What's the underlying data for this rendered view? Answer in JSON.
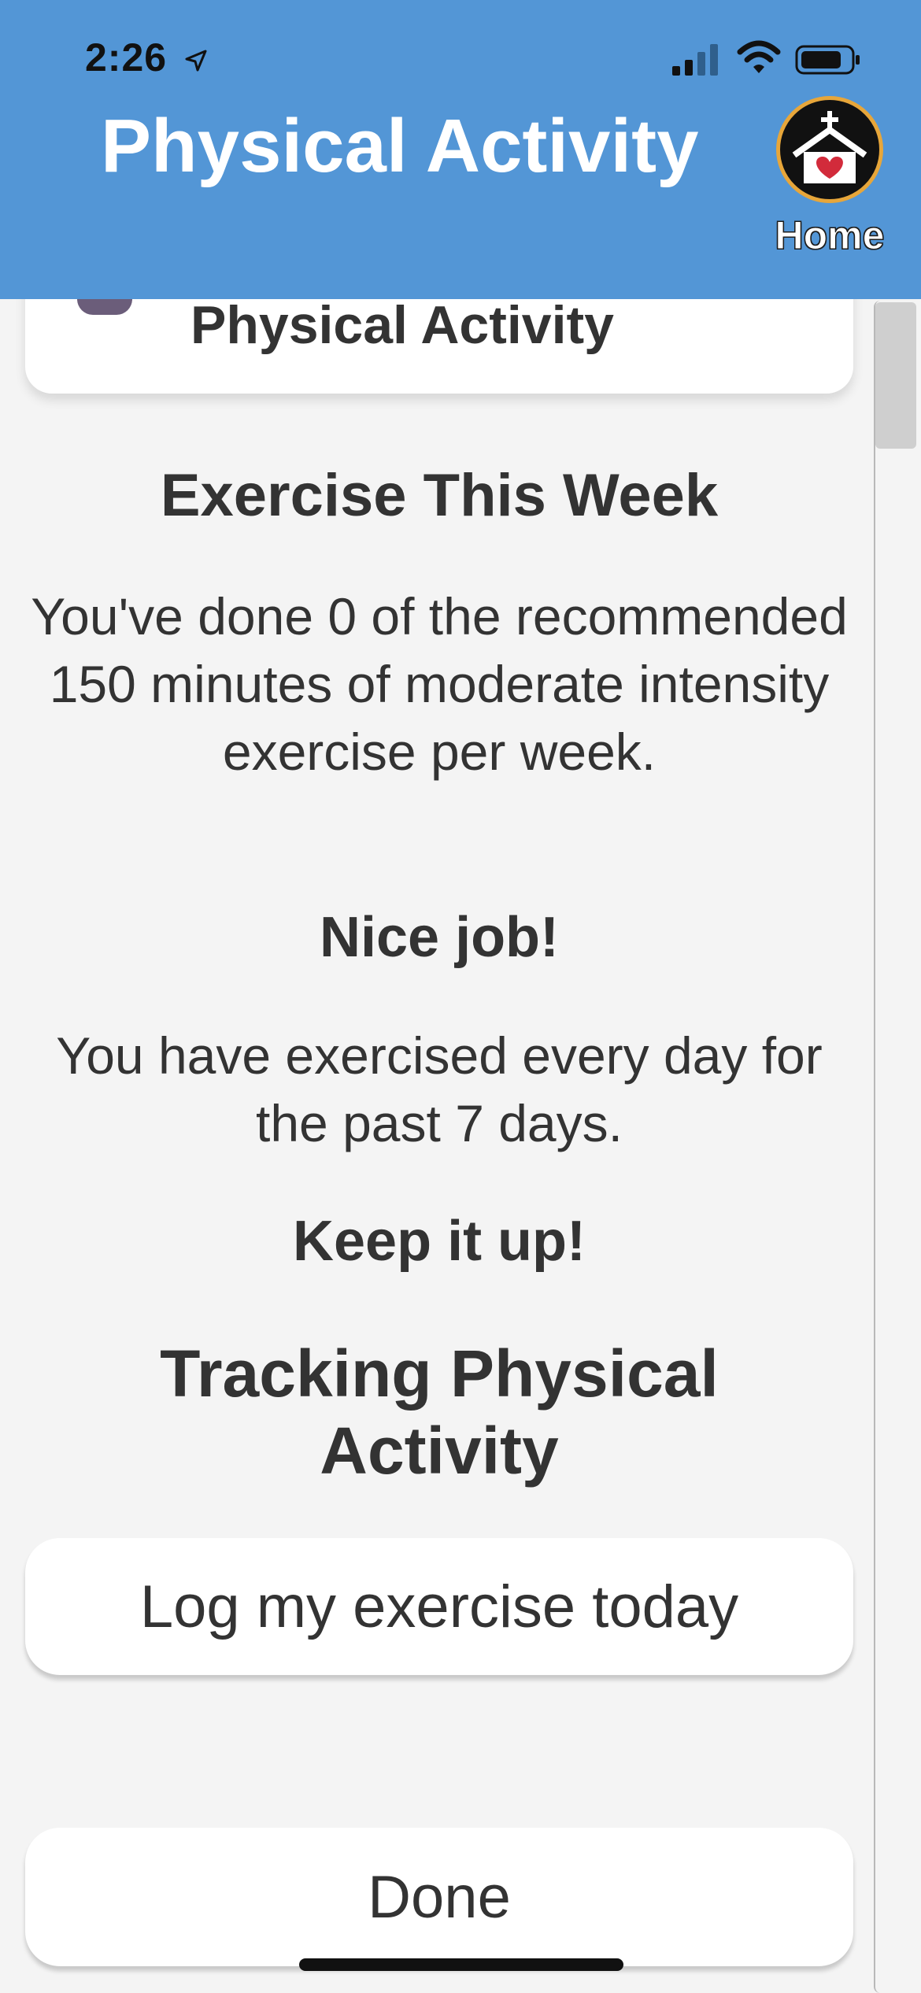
{
  "status_bar": {
    "time": "2:26"
  },
  "header": {
    "title": "Physical Activity",
    "home_label": "Home"
  },
  "top_card": {
    "title": "Physical Activity"
  },
  "exercise_section": {
    "heading": "Exercise This Week",
    "summary": "You've done 0 of the recommended 150 minutes of moderate intensity exercise per week.",
    "praise": "Nice job!",
    "streak": "You have exercised every day for the past 7 days.",
    "encouragement": "Keep it up!"
  },
  "tracking_section": {
    "heading": "Tracking Physical Activity",
    "log_button": "Log my exercise today"
  },
  "footer": {
    "done_button": "Done"
  },
  "colors": {
    "header_bg": "#5396d6",
    "page_bg": "#f4f4f4",
    "text": "#333333",
    "home_border": "#e7a63a",
    "heart": "#d22b3b"
  }
}
